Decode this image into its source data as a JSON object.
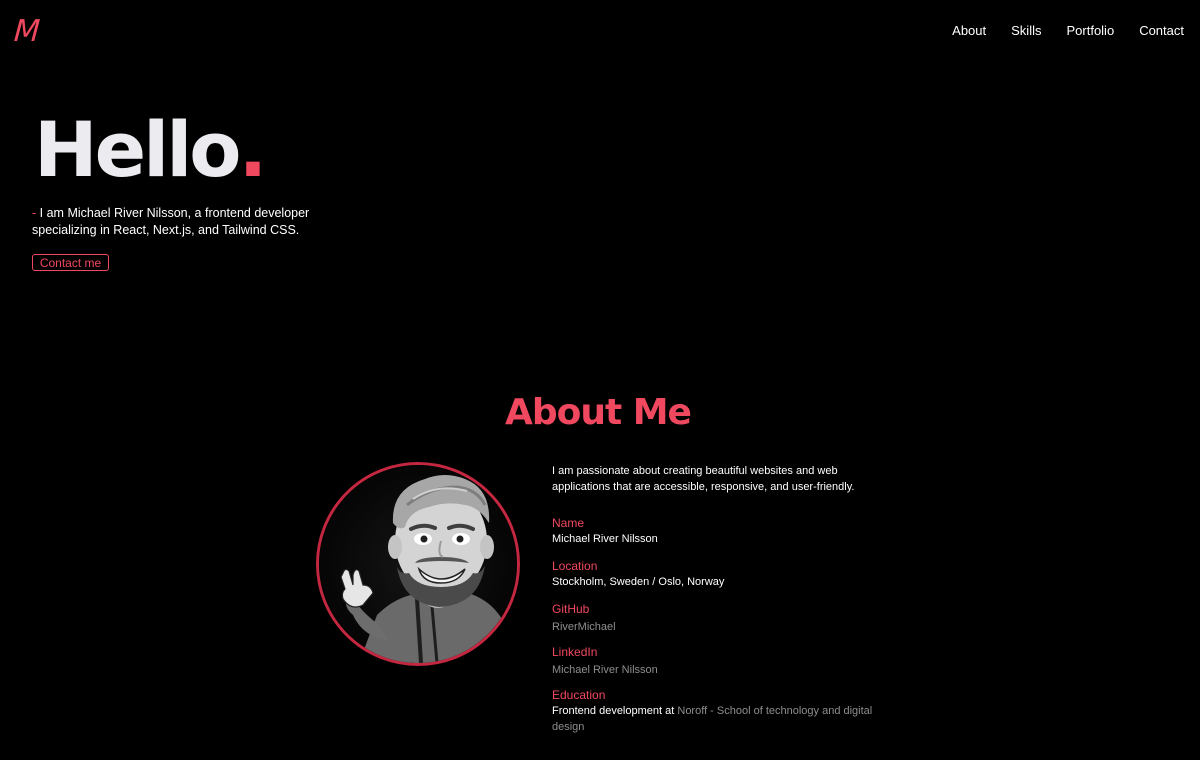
{
  "header": {
    "logo": "M",
    "nav": [
      "About",
      "Skills",
      "Portfolio",
      "Contact"
    ]
  },
  "hero": {
    "title": "Hello",
    "title_dot": ".",
    "dash": "-",
    "intro": "I am Michael River Nilsson, a frontend developer specializing in React, Next.js, and Tailwind CSS.",
    "cta_label": "Contact me"
  },
  "about": {
    "title": "About Me",
    "description": "I am passionate about creating beautiful websites and web applications that are accessible, responsive, and user-friendly.",
    "name_label": "Name",
    "name_value": "Michael River Nilsson",
    "location_label": "Location",
    "location_value": "Stockholm, Sweden / Oslo, Norway",
    "github_label": "GitHub",
    "github_value": "RiverMichael",
    "linkedin_label": "LinkedIn",
    "linkedin_value": "Michael River Nilsson",
    "education_label": "Education",
    "education_prefix": "Frontend development at",
    "education_school": "Noroff - School of technology and digital design"
  },
  "colors": {
    "accent": "#f0485f",
    "background": "#000000",
    "text": "#ffffff",
    "muted": "#8e8e8e"
  },
  "icons": [
    "avatar-illustration"
  ]
}
